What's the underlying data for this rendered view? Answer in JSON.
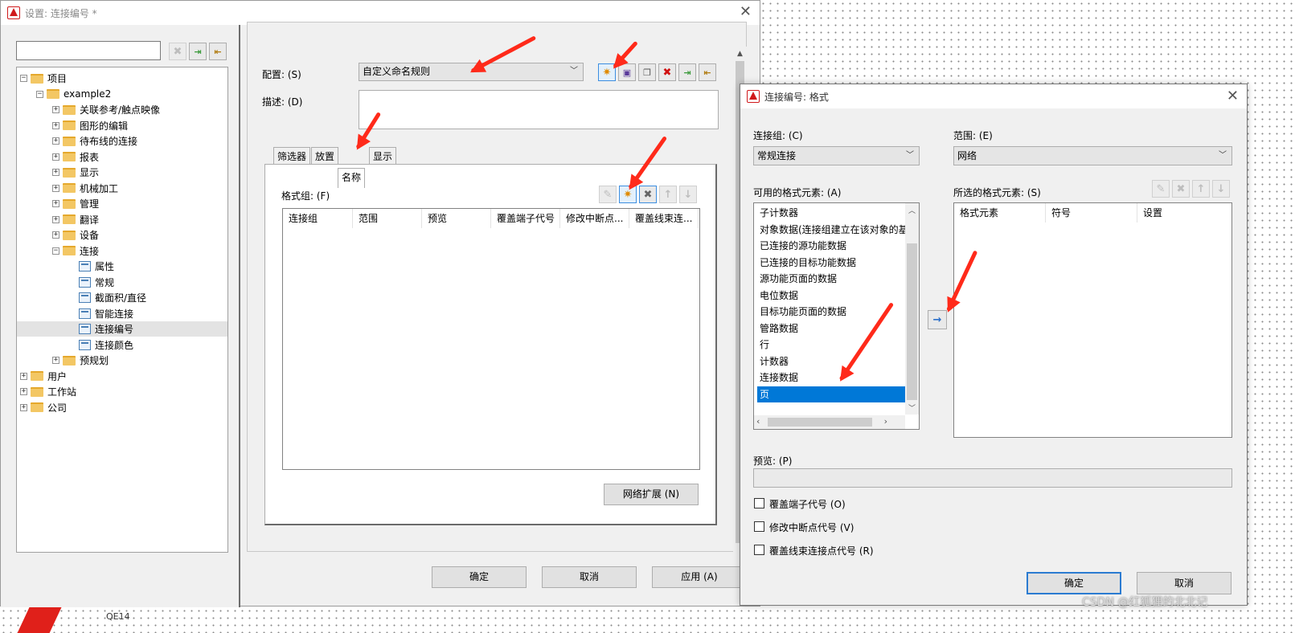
{
  "main_dialog": {
    "title": "设置: 连接编号 *",
    "tree": [
      {
        "label": "项目",
        "level": 0,
        "type": "folder",
        "expanded": true
      },
      {
        "label": "example2",
        "level": 1,
        "type": "folder",
        "expanded": true
      },
      {
        "label": "关联参考/触点映像",
        "level": 2,
        "type": "folder"
      },
      {
        "label": "图形的编辑",
        "level": 2,
        "type": "folder"
      },
      {
        "label": "待布线的连接",
        "level": 2,
        "type": "folder"
      },
      {
        "label": "报表",
        "level": 2,
        "type": "folder"
      },
      {
        "label": "显示",
        "level": 2,
        "type": "folder"
      },
      {
        "label": "机械加工",
        "level": 2,
        "type": "folder"
      },
      {
        "label": "管理",
        "level": 2,
        "type": "folder"
      },
      {
        "label": "翻译",
        "level": 2,
        "type": "folder"
      },
      {
        "label": "设备",
        "level": 2,
        "type": "folder"
      },
      {
        "label": "连接",
        "level": 2,
        "type": "folder",
        "expanded": true
      },
      {
        "label": "属性",
        "level": 3,
        "type": "page"
      },
      {
        "label": "常规",
        "level": 3,
        "type": "page"
      },
      {
        "label": "截面积/直径",
        "level": 3,
        "type": "page"
      },
      {
        "label": "智能连接",
        "level": 3,
        "type": "page"
      },
      {
        "label": "连接编号",
        "level": 3,
        "type": "page",
        "selected": true
      },
      {
        "label": "连接颜色",
        "level": 3,
        "type": "page"
      },
      {
        "label": "预规划",
        "level": 2,
        "type": "folder"
      },
      {
        "label": "用户",
        "level": 0,
        "type": "folder"
      },
      {
        "label": "工作站",
        "level": 0,
        "type": "folder"
      },
      {
        "label": "公司",
        "level": 0,
        "type": "folder"
      }
    ],
    "config_label": "配置: (S)",
    "config_value": "自定义命名规则",
    "description_label": "描述: (D)",
    "tabs": [
      "筛选器",
      "放置",
      "名称",
      "显示"
    ],
    "active_tab": "名称",
    "format_group_label": "格式组: (F)",
    "table_columns": [
      "连接组",
      "范围",
      "预览",
      "覆盖端子代号",
      "修改中断点...",
      "覆盖线束连..."
    ],
    "network_button": "网络扩展 (N)",
    "ok_button": "确定",
    "cancel_button": "取消",
    "apply_button": "应用 (A)"
  },
  "format_dialog": {
    "title": "连接编号: 格式",
    "connection_group_label": "连接组: (C)",
    "connection_group_value": "常规连接",
    "range_label": "范围: (E)",
    "range_value": "网络",
    "available_label": "可用的格式元素: (A)",
    "available_items": [
      "子计数器",
      "对象数据(连接组建立在该对象的基",
      "已连接的源功能数据",
      "已连接的目标功能数据",
      "源功能页面的数据",
      "电位数据",
      "目标功能页面的数据",
      "管路数据",
      "行",
      "计数器",
      "连接数据",
      "页"
    ],
    "selected_item": "页",
    "selected_label": "所选的格式元素: (S)",
    "selected_columns": [
      "格式元素",
      "符号",
      "设置"
    ],
    "preview_label": "预览: (P)",
    "checkboxes": [
      {
        "label": "覆盖端子代号 (O)",
        "checked": false
      },
      {
        "label": "修改中断点代号 (V)",
        "checked": false
      },
      {
        "label": "覆盖线束连接点代号 (R)",
        "checked": false
      }
    ],
    "ok_button": "确定",
    "cancel_button": "取消"
  },
  "background": {
    "partial_label": "QE14"
  },
  "watermark": "CSDN @红狐狸的北北记",
  "colors": {
    "accent": "#0078d7",
    "annotation_arrow": "#ff2a1a",
    "brand": "#d0191b"
  }
}
